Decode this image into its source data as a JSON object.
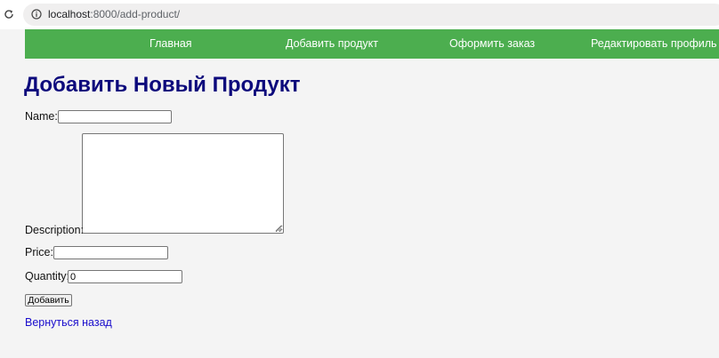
{
  "browser": {
    "url_host": "localhost",
    "url_path": ":8000/add-product/"
  },
  "nav": {
    "items": [
      {
        "label": "Главная"
      },
      {
        "label": "Добавить продукт"
      },
      {
        "label": "Оформить заказ"
      },
      {
        "label": "Редактировать профиль"
      }
    ],
    "background": "#4cae4f"
  },
  "page": {
    "title": "Добавить Новый Продукт",
    "title_color": "#0d0a7c"
  },
  "form": {
    "name_label": "Name:",
    "name_value": "",
    "description_label": "Description:",
    "description_value": "",
    "price_label": "Price:",
    "price_value": "",
    "quantity_label": "Quantity:",
    "quantity_value": "0",
    "submit_label": "Добавить"
  },
  "back_link": {
    "label": "Вернуться назад",
    "color": "#1a0dcc"
  }
}
